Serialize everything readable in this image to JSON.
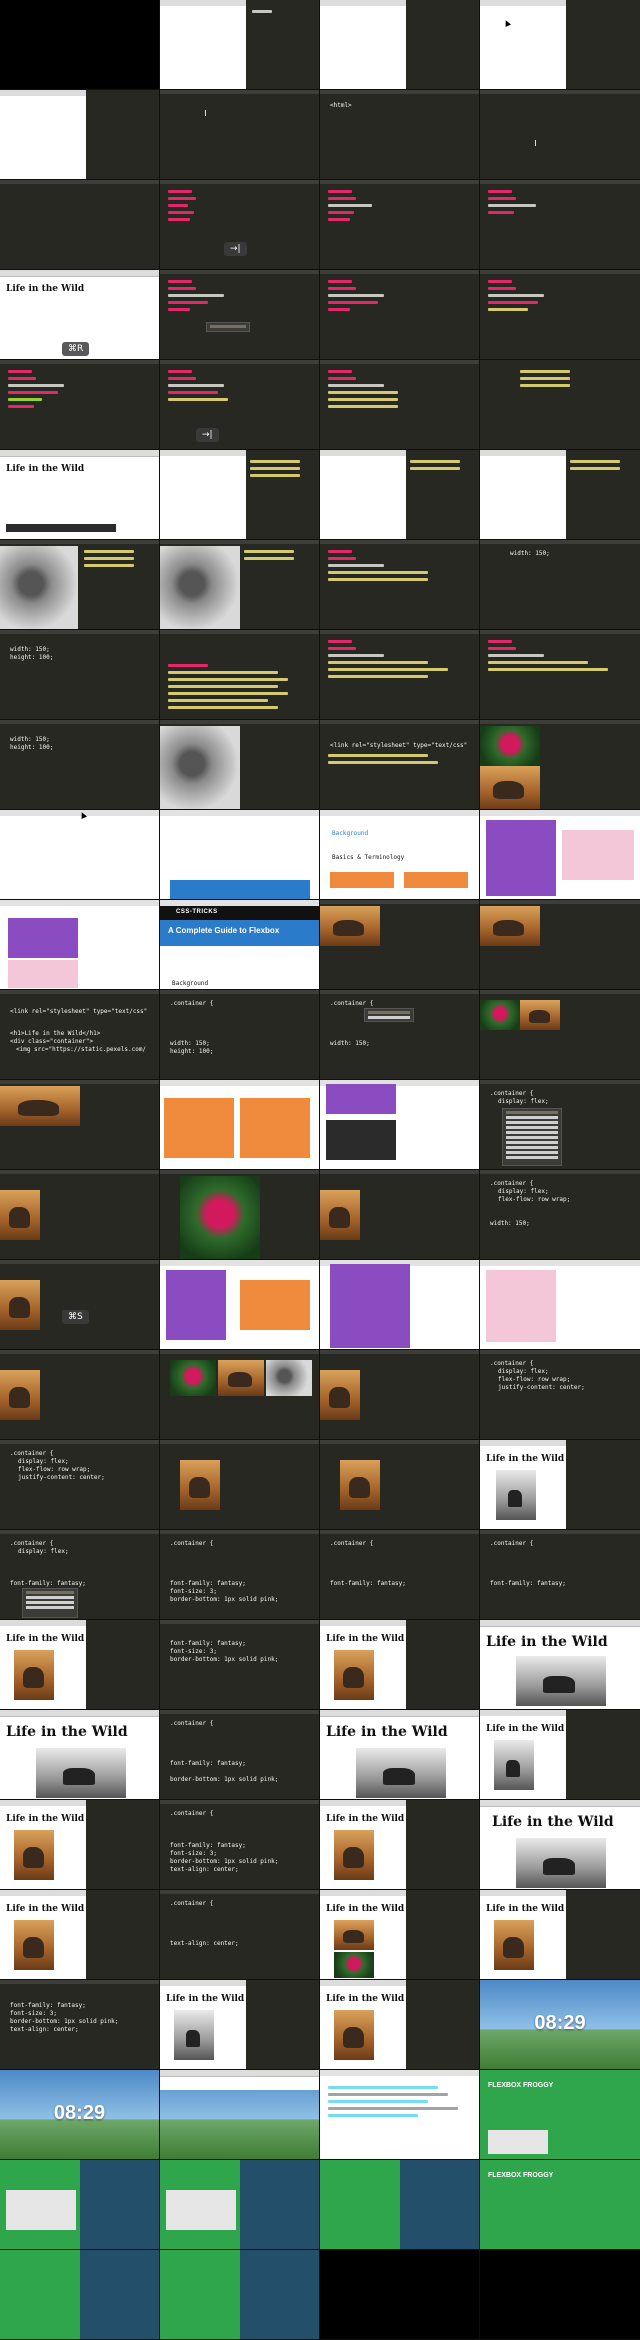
{
  "sheet": {
    "columns": 4,
    "rows": 26
  },
  "texts": {
    "life_in_the_wild": "Life in the Wild",
    "kbd_reload": "⌘R",
    "kbd_save": "⌘S",
    "kbd_tab": "→|",
    "css_tricks": "CSS-TRICKS",
    "guide_title": "A Complete Guide to Flexbox",
    "background": "Background",
    "basics_terminology": "Basics & Terminology",
    "clock": "08:29",
    "flexbox_froggy": "FLEXBOX FROGGY",
    "code_container": ".container {",
    "code_display": "display: flex;",
    "code_flex_flow": "flex-flow: row wrap;",
    "code_justify": "justify-content: center;",
    "code_font_family": "font-family: fantasy;",
    "code_font_size": "font-size: 3;",
    "code_border_bottom": "border-bottom: 1px solid pink;",
    "code_text_align": "text-align: center;",
    "code_width": "width: 150;",
    "code_height": "height: 100;",
    "code_close": "}",
    "code_h1": "<h1>Life in the Wild</h1>",
    "code_div": "<div class=\"container\">",
    "code_img": "<img src=\"https://static.pexels.com/",
    "code_link": "<link rel=\"stylesheet\" type=\"text/css\"",
    "code_html": "<html>",
    "code_head": "<head>",
    "code_body": "<body>",
    "code_html_close": "</html>",
    "popup_wrap": "wrap",
    "popup_nowrap": "nowrap",
    "popup_wrap_reverse": "wrap-reverse",
    "popup_flex": "flex",
    "popup_inline_flex": "inline-flex",
    "popup_border_bottom": "border-bottom",
    "popup_border_bottom_color": "border-bottom-color",
    "popup_border_bottom_style": "border-bottom-style",
    "popup_border_bottom_width": "border-bottom-width",
    "popup_baseline": "baseline",
    "popup_bottom": "bottom",
    "popup_box_sizing": "box-sizing",
    "popup_flex_direction": "flex-direction",
    "popup_flex_wrap": "flex-wrap",
    "popup_flex_flow": "flex-flow",
    "popup_flex_grow": "flex-grow",
    "popup_flex_shrink": "flex-shrink",
    "popup_flex_basis": "flex-basis",
    "popup_align_items": "align-items"
  },
  "colors": {
    "editor_bg": "#272822",
    "keyword": "#f92672",
    "attr": "#a6e22e",
    "string": "#e6db74",
    "guide_orange": "#f08a3c",
    "guide_purple": "#8b4cc1",
    "froggy_green": "#2fa64b"
  }
}
